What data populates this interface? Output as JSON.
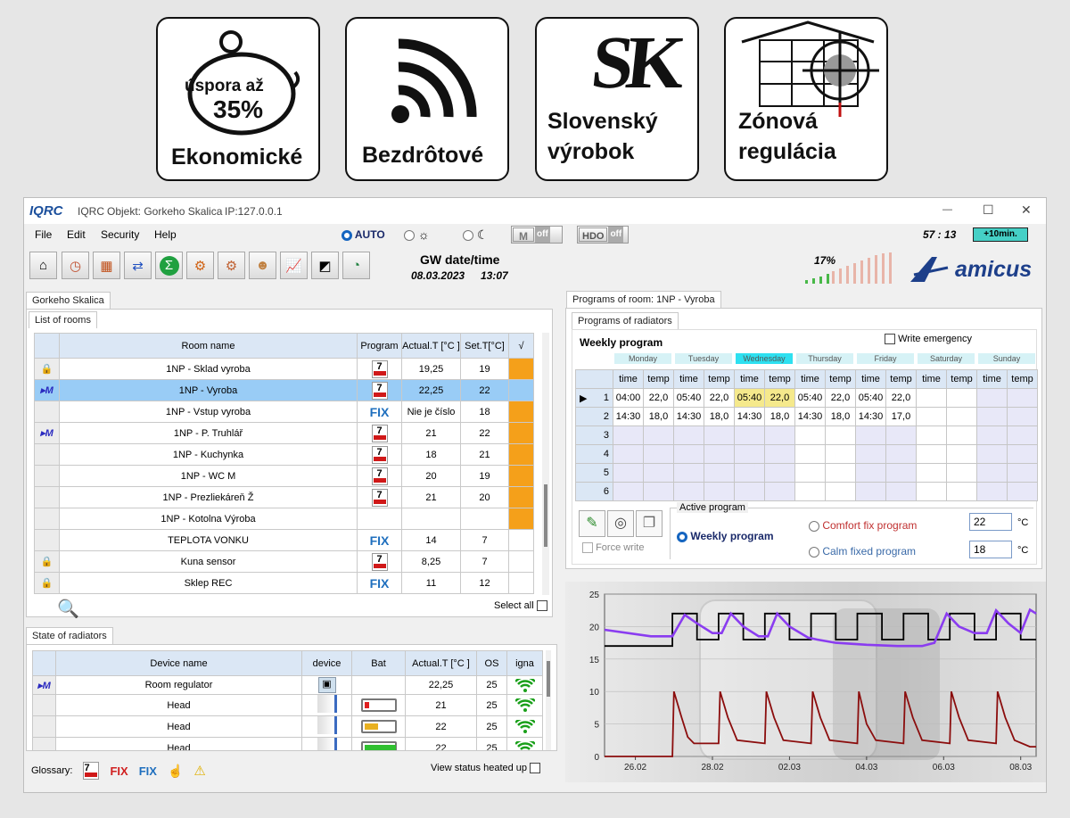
{
  "badges": [
    {
      "icon": "piggy-bank-icon",
      "line1": "úspora až",
      "line2": "35%",
      "label": "Ekonomické"
    },
    {
      "icon": "wireless-icon",
      "label": "Bezdrôtové"
    },
    {
      "icon": "sk-logo",
      "logo_text": "SK",
      "label_l1": "Slovenský",
      "label_l2": "výrobok"
    },
    {
      "icon": "zone-target-icon",
      "label_l1": "Zónová",
      "label_l2": "regulácia"
    }
  ],
  "window": {
    "logo": "IQRC",
    "app": "IQRC",
    "object": "Objekt: Gorkeho Skalica",
    "ip": "IP:127.0.0.1",
    "controls": {
      "minimize": "—",
      "maximize": "☐",
      "close": "✕"
    }
  },
  "menu": [
    "File",
    "Edit",
    "Security",
    "Help"
  ],
  "modes": {
    "auto": "AUTO",
    "sun": "☼",
    "moon": "☾",
    "m_label": "M",
    "m_state": "off",
    "hdo_label": "HDO",
    "hdo_state": "off"
  },
  "timer": {
    "value": "57 : 13",
    "button": "+10min."
  },
  "toolbar_icons": [
    "home-settings-icon",
    "clock-icon",
    "heater-icon",
    "sync-icon",
    "sum-icon",
    "gears-icon",
    "device-settings-icon",
    "users-icon",
    "chart-icon",
    "window-icon",
    "gauge-icon"
  ],
  "gw": {
    "title": "GW date/time",
    "date": "08.03.2023",
    "time": "13:07"
  },
  "signal": {
    "percent": "17%",
    "brand": "amicus"
  },
  "left": {
    "tab": "Gorkeho Skalica",
    "subtab": "List of rooms",
    "columns": [
      "Room name",
      "Program",
      "Actual.T [°C ]",
      "Set.T[°C]",
      "√"
    ],
    "rows": [
      {
        "icon": "lock-icon",
        "name": "1NP - Sklad vyroba",
        "prog": "7",
        "actual": "19,25",
        "set": "19",
        "flag": true
      },
      {
        "icon": "m-mode-icon",
        "name": "1NP - Vyroba",
        "prog": "7",
        "actual": "22,25",
        "set": "22",
        "flag": false,
        "active": true
      },
      {
        "icon": "",
        "name": "1NP - Vstup vyroba",
        "prog": "FIX",
        "actual": "Nie je číslo",
        "set": "18",
        "flag": true
      },
      {
        "icon": "m-mode-icon",
        "name": "1NP - P. Truhlář",
        "prog": "7",
        "actual": "21",
        "set": "22",
        "flag": true
      },
      {
        "icon": "",
        "name": "1NP - Kuchynka",
        "prog": "7",
        "actual": "18",
        "set": "21",
        "flag": true
      },
      {
        "icon": "",
        "name": "1NP - WC M",
        "prog": "7",
        "actual": "20",
        "set": "19",
        "flag": true
      },
      {
        "icon": "",
        "name": "1NP - Prezliekáreň Ž",
        "prog": "7",
        "actual": "21",
        "set": "20",
        "flag": true
      },
      {
        "icon": "",
        "name": "1NP - Kotolna Výroba",
        "prog": "",
        "actual": "",
        "set": "",
        "flag": true
      },
      {
        "icon": "",
        "name": "TEPLOTA VONKU",
        "prog": "FIX",
        "actual": "14",
        "set": "7",
        "flag": false
      },
      {
        "icon": "lock-icon",
        "name": "Kuna sensor",
        "prog": "7",
        "actual": "8,25",
        "set": "7",
        "flag": false
      },
      {
        "icon": "lock-icon",
        "name": "Sklep REC",
        "prog": "FIX",
        "actual": "11",
        "set": "12",
        "flag": false
      }
    ],
    "select_all": "Select all"
  },
  "radiators": {
    "tab": "State of radiators",
    "columns": [
      "Device name",
      "device",
      "Bat",
      "Actual.T [°C ]",
      "OS",
      "igna"
    ],
    "rows": [
      {
        "icon": "m-mode-icon",
        "name": "Room regulator",
        "device": "regulator",
        "bat": "",
        "actual": "22,25",
        "os": "25"
      },
      {
        "icon": "",
        "name": "Head",
        "device": "head",
        "bat": "low",
        "actual": "21",
        "os": "25"
      },
      {
        "icon": "",
        "name": "Head",
        "device": "head",
        "bat": "mid",
        "actual": "22",
        "os": "25"
      },
      {
        "icon": "",
        "name": "Head",
        "device": "head",
        "bat": "full",
        "actual": "22",
        "os": "25"
      }
    ],
    "glossary": "Glossary:",
    "gl_prog": "7",
    "gl_fix1": "FIX",
    "gl_fix2": "FIX",
    "view_status": "View status heated up"
  },
  "programs": {
    "tab": "Programs of room: 1NP - Vyroba",
    "subtab": "Programs of radiators",
    "title": "Weekly program",
    "emergency": "Write emergency",
    "days": [
      "Monday",
      "Tuesday",
      "Wednesday",
      "Thursday",
      "Friday",
      "Saturday",
      "Sunday"
    ],
    "col_time": "time",
    "col_temp": "temp",
    "rows": [
      {
        "n": "1",
        "cells": [
          "04:00",
          "22,0",
          "05:40",
          "22,0",
          "05:40",
          "22,0",
          "05:40",
          "22,0",
          "05:40",
          "22,0",
          "",
          "",
          "",
          ""
        ]
      },
      {
        "n": "2",
        "cells": [
          "14:30",
          "18,0",
          "14:30",
          "18,0",
          "14:30",
          "18,0",
          "14:30",
          "18,0",
          "14:30",
          "17,0",
          "",
          "",
          "",
          ""
        ]
      },
      {
        "n": "3",
        "cells": []
      },
      {
        "n": "4",
        "cells": []
      },
      {
        "n": "5",
        "cells": []
      },
      {
        "n": "6",
        "cells": []
      }
    ],
    "force_write": "Force write",
    "active_program": "Active program",
    "weekly": "Weekly program",
    "comfort": "Comfort fix program",
    "calm": "Calm fixed program",
    "comfort_val": "22",
    "calm_val": "18",
    "unit": "°C"
  },
  "chart_data": {
    "type": "line",
    "yticks": [
      "25",
      "20",
      "15",
      "10",
      "5",
      "0"
    ],
    "xticks": [
      "26.02",
      "28.02",
      "02.03",
      "04.03",
      "06.03",
      "08.03"
    ],
    "ylim": [
      0,
      25
    ],
    "x_days": [
      0,
      14
    ],
    "series": [
      {
        "color": "#000000",
        "points": [
          [
            0,
            17
          ],
          [
            2.2,
            17
          ],
          [
            2.2,
            22
          ],
          [
            3,
            22
          ],
          [
            3,
            18
          ],
          [
            3.7,
            18
          ],
          [
            3.7,
            22
          ],
          [
            4.5,
            22
          ],
          [
            4.5,
            18
          ],
          [
            5.2,
            18
          ],
          [
            5.2,
            22
          ],
          [
            6,
            22
          ],
          [
            6,
            18
          ],
          [
            6.7,
            18
          ],
          [
            6.7,
            22
          ],
          [
            7.5,
            22
          ],
          [
            7.5,
            18
          ],
          [
            8.2,
            18
          ],
          [
            8.2,
            22
          ],
          [
            9,
            22
          ],
          [
            9,
            18
          ],
          [
            9.7,
            18
          ],
          [
            9.7,
            22
          ],
          [
            10.5,
            22
          ],
          [
            10.5,
            18
          ],
          [
            11.2,
            18
          ],
          [
            11.2,
            22
          ],
          [
            12,
            22
          ],
          [
            12,
            18
          ],
          [
            12.7,
            18
          ],
          [
            12.7,
            22
          ],
          [
            13.5,
            22
          ],
          [
            13.5,
            18
          ],
          [
            14,
            18
          ]
        ]
      },
      {
        "color": "#8a3cf0",
        "points": [
          [
            0,
            19.5
          ],
          [
            1.5,
            18.5
          ],
          [
            2.2,
            18.5
          ],
          [
            2.6,
            21.8
          ],
          [
            3,
            20.5
          ],
          [
            3.5,
            19
          ],
          [
            3.8,
            19
          ],
          [
            4.1,
            22
          ],
          [
            4.5,
            20
          ],
          [
            5,
            18.5
          ],
          [
            5.3,
            18.5
          ],
          [
            5.6,
            22
          ],
          [
            6,
            20
          ],
          [
            6.6,
            18.3
          ],
          [
            6.9,
            18
          ],
          [
            7.5,
            17.5
          ],
          [
            8.5,
            17.2
          ],
          [
            9.5,
            17
          ],
          [
            10.3,
            17
          ],
          [
            10.7,
            17.5
          ],
          [
            11.1,
            22
          ],
          [
            11.5,
            20
          ],
          [
            12,
            19
          ],
          [
            12.4,
            19
          ],
          [
            12.7,
            22.5
          ],
          [
            13.1,
            20.5
          ],
          [
            13.5,
            19
          ],
          [
            13.8,
            22.6
          ],
          [
            14,
            22
          ]
        ]
      },
      {
        "color": "#8b0d0d",
        "points": [
          [
            0,
            0
          ],
          [
            2.2,
            0
          ],
          [
            2.25,
            10
          ],
          [
            2.5,
            6
          ],
          [
            2.7,
            3
          ],
          [
            2.9,
            2
          ],
          [
            3.7,
            2
          ],
          [
            3.75,
            10
          ],
          [
            4,
            6
          ],
          [
            4.3,
            2.5
          ],
          [
            5.2,
            2
          ],
          [
            5.25,
            10
          ],
          [
            5.5,
            6
          ],
          [
            5.8,
            2.5
          ],
          [
            6.7,
            2
          ],
          [
            6.75,
            10
          ],
          [
            7,
            6
          ],
          [
            7.3,
            2.5
          ],
          [
            8.2,
            2
          ],
          [
            8.25,
            10
          ],
          [
            8.5,
            5
          ],
          [
            8.8,
            2.5
          ],
          [
            9.7,
            2
          ],
          [
            9.75,
            10
          ],
          [
            10,
            6
          ],
          [
            10.3,
            2.5
          ],
          [
            11.2,
            2
          ],
          [
            11.25,
            10
          ],
          [
            11.5,
            6
          ],
          [
            11.8,
            2.5
          ],
          [
            12.7,
            2
          ],
          [
            12.75,
            10
          ],
          [
            13,
            6
          ],
          [
            13.3,
            2.5
          ],
          [
            13.8,
            1.5
          ],
          [
            14,
            1.5
          ]
        ]
      }
    ]
  }
}
